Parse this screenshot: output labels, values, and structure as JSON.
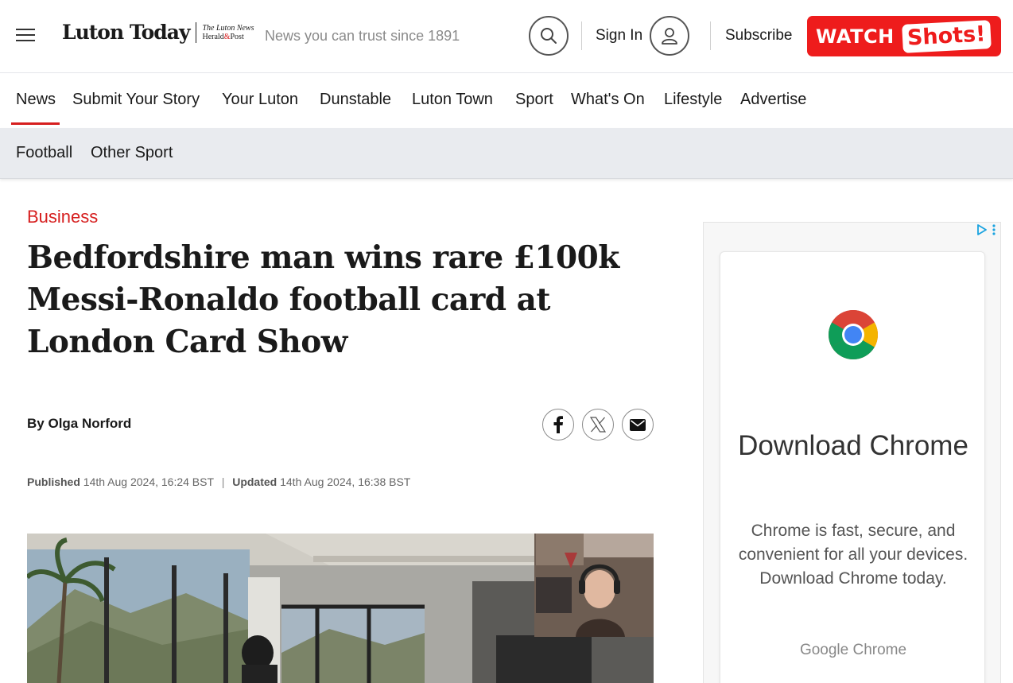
{
  "header": {
    "logo_main": "Luton Today",
    "logo_sub_line1": "The Luton News",
    "logo_sub_line2a": "Herald",
    "logo_sub_line2b": "&",
    "logo_sub_line2c": "Post",
    "tagline": "News you can trust since 1891",
    "sign_in": "Sign In",
    "subscribe": "Subscribe",
    "watch_label": "WATCH",
    "shots_label": "Shots!"
  },
  "nav": {
    "items": [
      "News",
      "Submit Your Story",
      "Your Luton",
      "Dunstable",
      "Luton Town",
      "Sport",
      "What's On",
      "Lifestyle",
      "Advertise"
    ],
    "active": "News"
  },
  "subnav": {
    "items": [
      "Football",
      "Other Sport"
    ]
  },
  "article": {
    "category": "Business",
    "headline": "Bedfordshire man wins rare £100k Messi-Ronaldo football card at London Card Show",
    "byline_prefix": "By",
    "author": "Olga Norford",
    "published_label": "Published",
    "published_date": "14th Aug 2024, 16:24 BST",
    "separator": "|",
    "updated_label": "Updated",
    "updated_date": "14th Aug 2024, 16:38 BST"
  },
  "ad": {
    "title": "Download Chrome",
    "text": "Chrome is fast, secure, and convenient for all your devices. Download Chrome today.",
    "brand": "Google Chrome"
  },
  "icons": {
    "menu": "hamburger-icon",
    "search": "search-icon",
    "profile": "user-icon",
    "facebook": "facebook-icon",
    "x": "x-icon",
    "mail": "mail-icon",
    "ad_choices": "ad-choices-icon",
    "chrome": "chrome-logo"
  },
  "colors": {
    "accent_red": "#d61f1f",
    "watch_red": "#ee1c1c",
    "subnav_bg": "#e9ebef"
  }
}
